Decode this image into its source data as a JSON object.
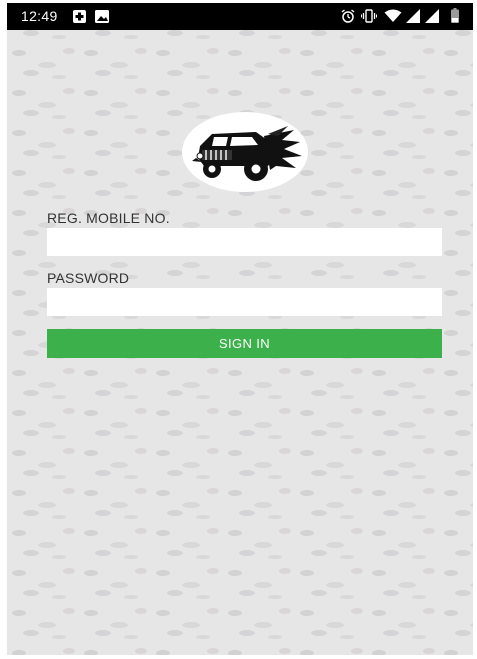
{
  "status_bar": {
    "time": "12:49",
    "left_icons": [
      "medical-notification-icon",
      "image-notification-icon"
    ],
    "right_icons": [
      "alarm-icon",
      "vibrate-icon",
      "wifi-icon",
      "signal-icon",
      "signal-icon-2",
      "battery-icon"
    ]
  },
  "logo": {
    "icon": "jeep-logo-icon"
  },
  "login_form": {
    "mobile_label": "REG. MOBILE NO.",
    "mobile_value": "",
    "password_label": "PASSWORD",
    "password_value": "",
    "signin_label": "SIGN IN"
  },
  "colors": {
    "status_bar": "#000000",
    "background": "#e6e6e6",
    "input_background": "#ffffff",
    "button": "#3cb04a",
    "button_text": "#ffffff"
  }
}
